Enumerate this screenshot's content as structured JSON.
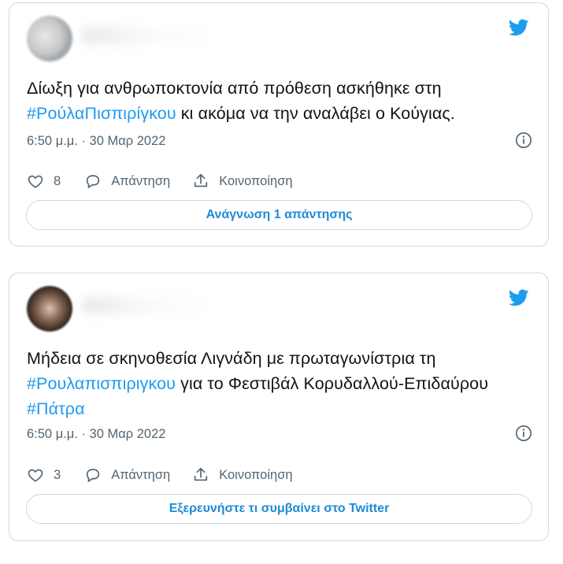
{
  "colors": {
    "accent": "#1d9bf0",
    "muted": "#536471",
    "border": "#cfd9de"
  },
  "icons": {
    "brand": "twitter-bird-icon",
    "info": "info-circle-icon",
    "like": "heart-icon",
    "reply": "speech-bubble-icon",
    "share": "upload-share-icon"
  },
  "tweets": [
    {
      "text_before": "Δίωξη για ανθρωποκτονία από πρόθεση ασκήθηκε στη ",
      "hashtag1": "#ΡούλαΠισπιρίγκου",
      "text_after": " κι ακόμα να την αναλάβει ο Κούγιας.",
      "timestamp": "6:50 μ.μ. · 30 Μαρ 2022",
      "likes": "8",
      "reply_label": "Απάντηση",
      "share_label": "Κοινοποίηση",
      "cta_label": "Ανάγνωση 1 απάντησης"
    },
    {
      "text_before": "Μήδεια σε σκηνοθεσία Λιγνάδη με πρωταγωνίστρια τη ",
      "hashtag1": "#Ρουλαπισπιριγκου",
      "text_middle": " για το Φεστιβάλ Κορυδαλλού-Επιδαύρου ",
      "hashtag2": "#Πάτρα",
      "timestamp": "6:50 μ.μ. · 30 Μαρ 2022",
      "likes": "3",
      "reply_label": "Απάντηση",
      "share_label": "Κοινοποίηση",
      "cta_label": "Εξερευνήστε τι συμβαίνει στο Twitter"
    }
  ]
}
